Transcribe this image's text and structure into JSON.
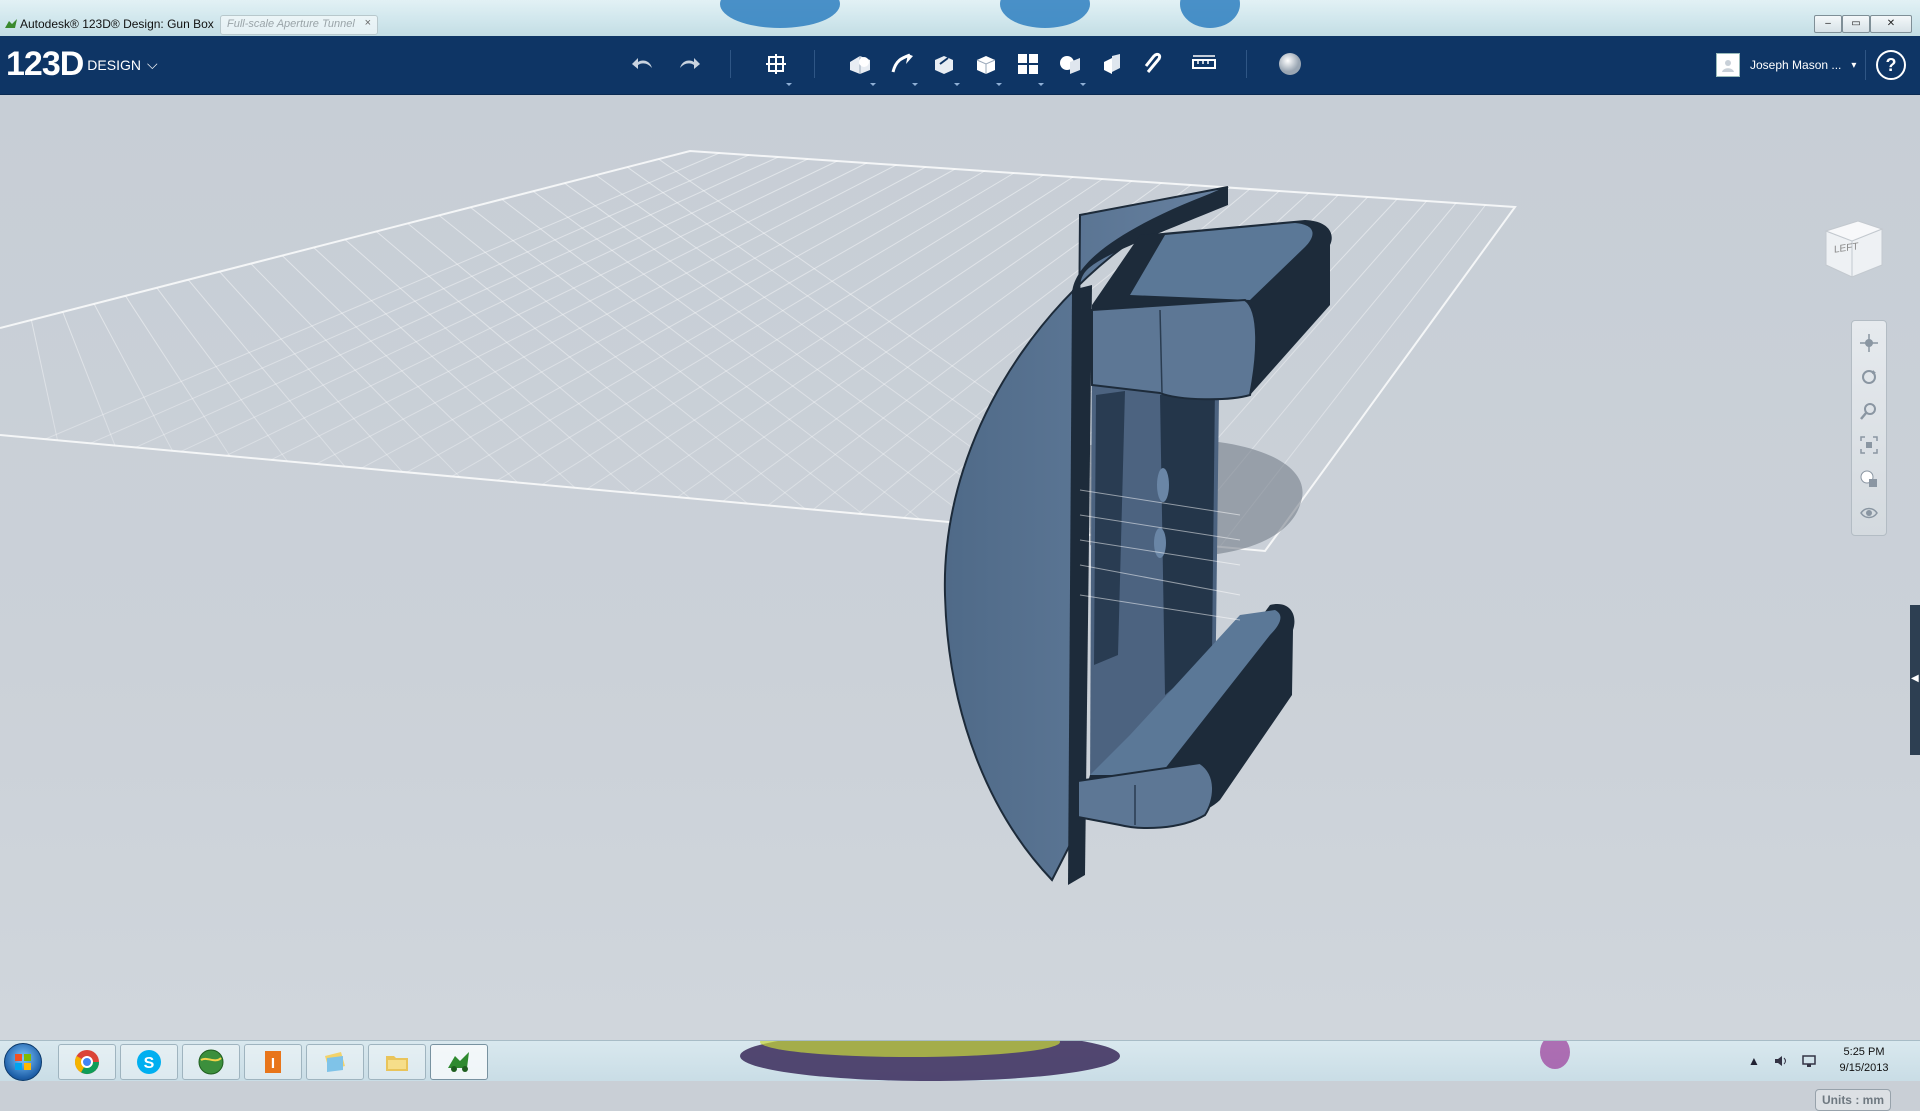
{
  "window": {
    "title": "Autodesk® 123D® Design: Gun Box",
    "tab_title": "Full-scale Aperture Tunnel",
    "tab_close": "×",
    "min_glyph": "–",
    "max_glyph": "▭",
    "close_glyph": "✕"
  },
  "app": {
    "brand_number": "123D",
    "brand_word": "DESIGN",
    "brand_caret": "⌵"
  },
  "toolbar": {
    "tools": [
      "undo",
      "redo",
      "transform",
      "primitives",
      "sketch",
      "construct",
      "modify",
      "pattern",
      "grouping",
      "combine",
      "snap",
      "measure",
      "material"
    ]
  },
  "user": {
    "name": "Joseph Mason ...",
    "caret": "▾",
    "help": "?"
  },
  "viewcube": {
    "face_label": "LEFT"
  },
  "navbar": {
    "tools": [
      "pan",
      "orbit",
      "zoom",
      "fit",
      "view-mode",
      "visibility"
    ]
  },
  "side_tab_glyph": "◀",
  "units": {
    "label": "Units : mm"
  },
  "taskbar": {
    "apps": [
      "chrome",
      "skype",
      "maps",
      "app-i",
      "files",
      "explorer",
      "123d-design"
    ],
    "active_app": "123d-design"
  },
  "clock": {
    "time": "5:25 PM",
    "date": "9/15/2013"
  },
  "colors": {
    "toolbar_bg": "#0e3565",
    "model_face": "#5d7795",
    "model_dark": "#1d2b3a",
    "viewport_bg": "#c9cfd6"
  }
}
